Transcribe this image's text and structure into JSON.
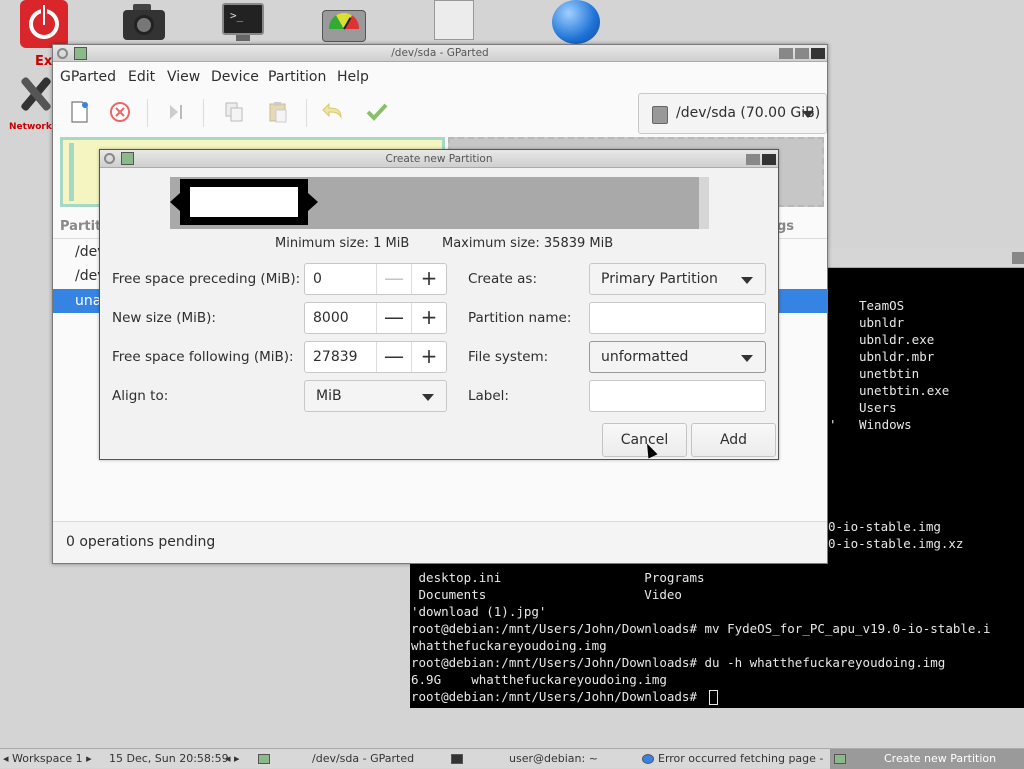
{
  "desktop": {
    "power_label": "Ex",
    "tools_label": "Network",
    "term_icon_text": ">_"
  },
  "terminal": {
    "right_listing": [
      "TeamOS",
      "ubnldr",
      "ubnldr.exe",
      "ubnldr.mbr",
      "unetbtin",
      "unetbtin.exe",
      "Users",
      "Windows"
    ],
    "stray_quote": "'",
    "partial_lines": [
      "0-io-stable.img",
      "0-io-stable.img.xz"
    ],
    "lines": [
      " desktop.ini                   Programs",
      " Documents                     Video",
      "'download (1).jpg'",
      "root@debian:/mnt/Users/John/Downloads# mv FydeOS_for_PC_apu_v19.0-io-stable.i",
      "whatthefuckareyoudoing.img",
      "root@debian:/mnt/Users/John/Downloads# du -h whatthefuckareyoudoing.img",
      "6.9G    whatthefuckareyoudoing.img",
      "root@debian:/mnt/Users/John/Downloads# "
    ]
  },
  "gparted": {
    "title": "/dev/sda - GParted",
    "menu": [
      "GParted",
      "Edit",
      "View",
      "Device",
      "Partition",
      "Help"
    ],
    "device_selector": "/dev/sda (70.00 GiB)",
    "list_header_partition": "Partiti",
    "list_header_flags": "gs",
    "rows": [
      "/dev",
      "/dev",
      "una"
    ],
    "status": "0 operations pending"
  },
  "dialog": {
    "title": "Create new Partition",
    "min_size": "Minimum size: 1 MiB",
    "max_size": "Maximum size: 35839 MiB",
    "free_preceding_label": "Free space preceding (MiB):",
    "free_preceding_value": "0",
    "new_size_label": "New size (MiB):",
    "new_size_value": "8000",
    "free_following_label": "Free space following (MiB):",
    "free_following_value": "27839",
    "align_label": "Align to:",
    "align_value": "MiB",
    "create_as_label": "Create as:",
    "create_as_value": "Primary Partition",
    "partition_name_label": "Partition name:",
    "partition_name_value": "",
    "file_system_label": "File system:",
    "file_system_value": "unformatted",
    "label_label": "Label:",
    "label_value": "",
    "cancel": "Cancel",
    "add": "Add",
    "minus": "—",
    "plus": "+"
  },
  "taskbar": {
    "workspace": "Workspace 1",
    "datetime": "15 Dec, Sun 20:58:59",
    "gparted_task": "/dev/sda - GParted",
    "terminal_task": "user@debian: ~",
    "browser_task": "Error occurred fetching page -",
    "dialog_task": "Create new Partition"
  },
  "colors": {
    "selection": "#3584e4",
    "partition_used": "#f5f5c2",
    "partition_border": "#a6d8c5",
    "unallocated": "#c6c6c6",
    "power_red": "#d9262a"
  }
}
